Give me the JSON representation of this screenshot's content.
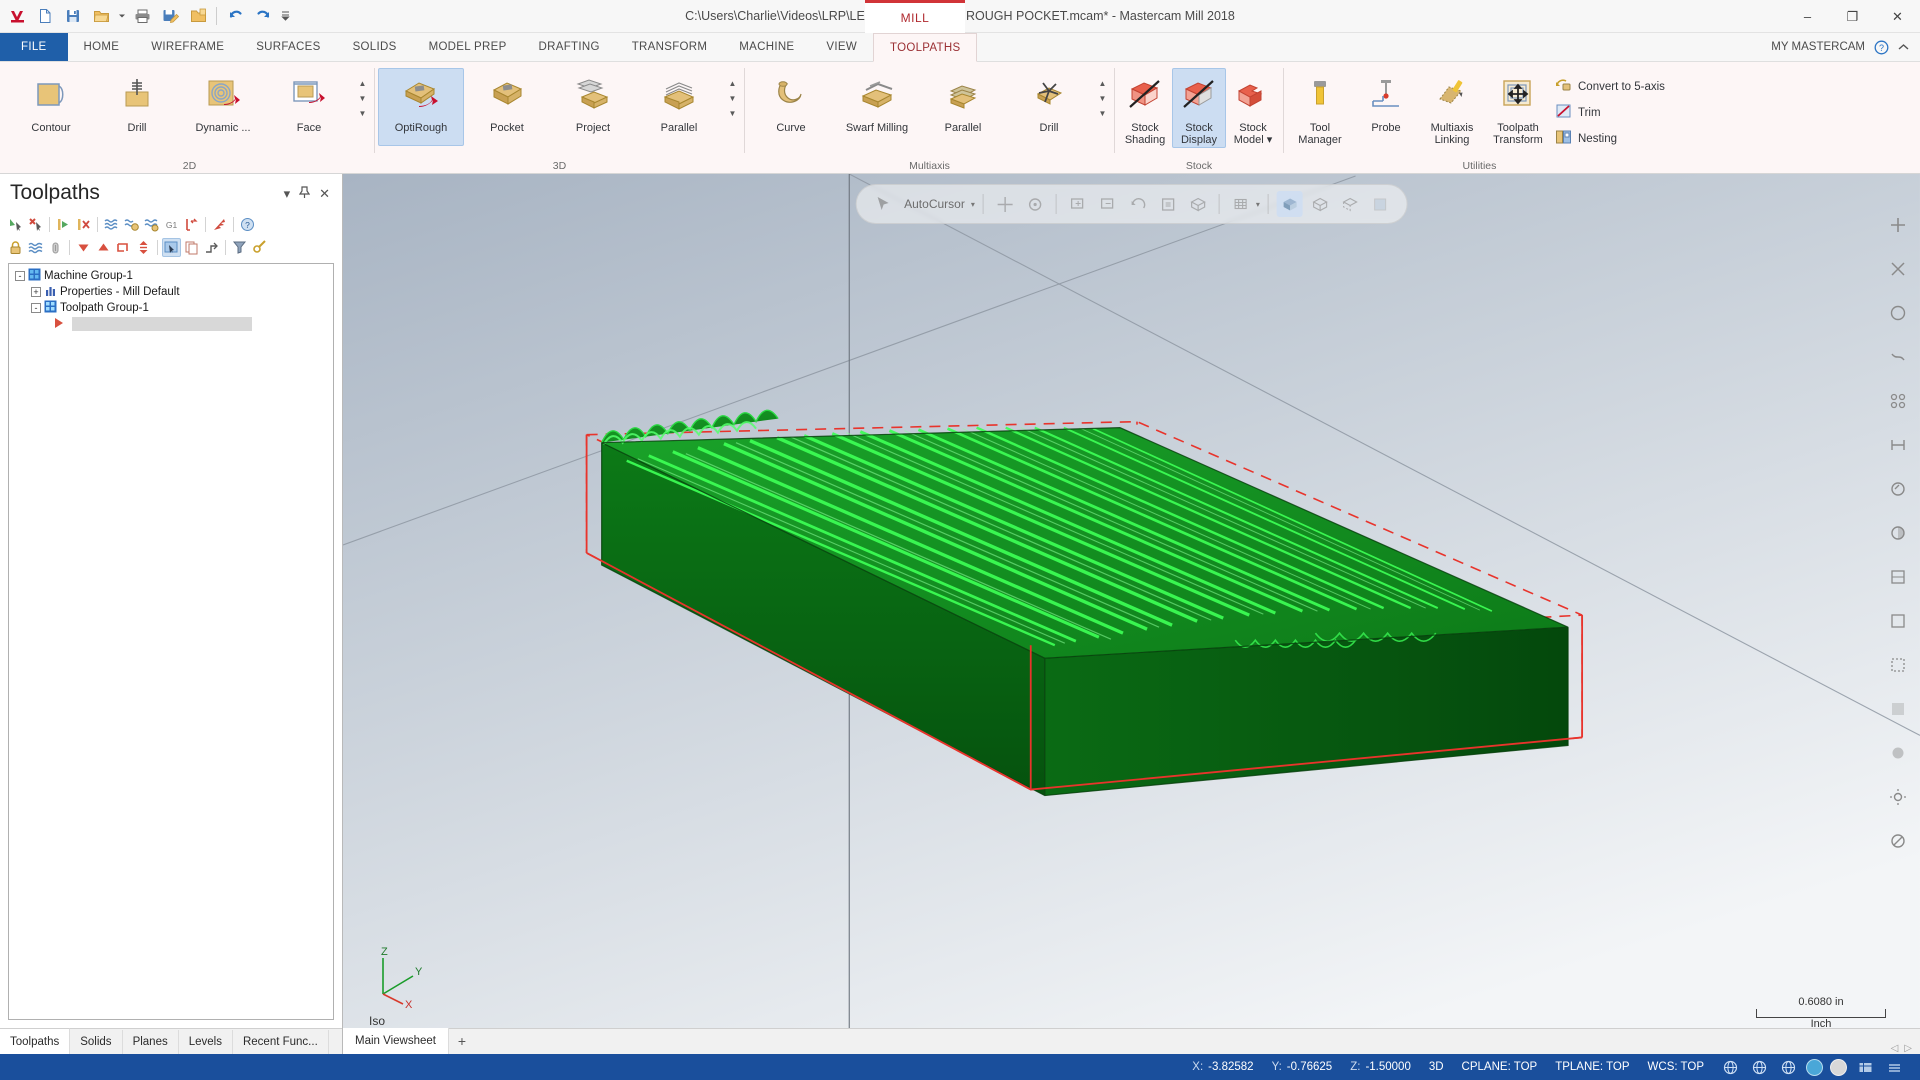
{
  "titlebar": {
    "title": "C:\\Users\\Charlie\\Videos\\LRP\\LEGACY SURFACE ROUGH POCKET.mcam* - Mastercam Mill 2018",
    "mill_tab": "MILL",
    "quick_access": [
      {
        "name": "mastercam-logo-icon",
        "label": "M"
      },
      {
        "name": "new-file-icon",
        "label": "New"
      },
      {
        "name": "save-icon",
        "label": "Save"
      },
      {
        "name": "open-folder-icon",
        "label": "Open"
      },
      {
        "name": "open-dropdown-icon",
        "label": "Open options"
      },
      {
        "name": "print-icon",
        "label": "Print"
      },
      {
        "name": "save-as-icon",
        "label": "Save As"
      },
      {
        "name": "import-folder-icon",
        "label": "Import"
      },
      {
        "name": "undo-icon",
        "label": "Undo"
      },
      {
        "name": "redo-icon",
        "label": "Redo"
      },
      {
        "name": "customize-qat-icon",
        "label": "Customize Quick Access Toolbar"
      }
    ],
    "window_controls": {
      "minimize": "–",
      "maximize": "❐",
      "close": "✕"
    }
  },
  "ribbon_tabs": {
    "items": [
      {
        "label": "FILE",
        "active": false,
        "file": true
      },
      {
        "label": "HOME",
        "active": false
      },
      {
        "label": "WIREFRAME",
        "active": false
      },
      {
        "label": "SURFACES",
        "active": false
      },
      {
        "label": "SOLIDS",
        "active": false
      },
      {
        "label": "MODEL PREP",
        "active": false
      },
      {
        "label": "DRAFTING",
        "active": false
      },
      {
        "label": "TRANSFORM",
        "active": false
      },
      {
        "label": "MACHINE",
        "active": false
      },
      {
        "label": "VIEW",
        "active": false
      },
      {
        "label": "TOOLPATHS",
        "active": true
      }
    ],
    "account_label": "MY MASTERCAM",
    "help_icon": "help-icon",
    "collapse_icon": "collapse-ribbon-icon"
  },
  "ribbon": {
    "groups": [
      {
        "label": "2D",
        "buttons": [
          {
            "label": "Contour",
            "icon": "contour-icon",
            "selected": false
          },
          {
            "label": "Drill",
            "icon": "drill-icon",
            "selected": false
          },
          {
            "label": "Dynamic ...",
            "icon": "dynamic-mill-icon",
            "selected": false
          },
          {
            "label": "Face",
            "icon": "face-icon",
            "selected": false
          }
        ],
        "has_spinner": true
      },
      {
        "label": "3D",
        "buttons": [
          {
            "label": "OptiRough",
            "icon": "optirough-icon",
            "selected": true
          },
          {
            "label": "Pocket",
            "icon": "pocket-icon",
            "selected": false
          },
          {
            "label": "Project",
            "icon": "project-icon",
            "selected": false
          },
          {
            "label": "Parallel",
            "icon": "parallel-icon",
            "selected": false
          }
        ],
        "has_spinner": true
      },
      {
        "label": "Multiaxis",
        "buttons": [
          {
            "label": "Curve",
            "icon": "curve-icon",
            "selected": false
          },
          {
            "label": "Swarf Milling",
            "icon": "swarf-milling-icon",
            "selected": false
          },
          {
            "label": "Parallel",
            "icon": "multiaxis-parallel-icon",
            "selected": false
          },
          {
            "label": "Drill",
            "icon": "multiaxis-drill-icon",
            "selected": false
          }
        ],
        "has_spinner": true
      },
      {
        "label": "Stock",
        "buttons": [
          {
            "label": "Stock Shading",
            "icon": "stock-shading-icon",
            "selected": false
          },
          {
            "label": "Stock Display",
            "icon": "stock-display-icon",
            "selected": true
          },
          {
            "label": "Stock Model",
            "icon": "stock-model-icon",
            "selected": false,
            "dropdown": true
          }
        ],
        "has_spinner": false
      },
      {
        "label": "Utilities",
        "buttons": [
          {
            "label": "Tool Manager",
            "icon": "tool-manager-icon",
            "selected": false
          },
          {
            "label": "Probe",
            "icon": "probe-icon",
            "selected": false
          },
          {
            "label": "Multiaxis Linking",
            "icon": "multiaxis-linking-icon",
            "selected": false
          },
          {
            "label": "Toolpath Transform",
            "icon": "toolpath-transform-icon",
            "selected": false
          }
        ],
        "small_buttons": [
          {
            "label": "Convert to 5-axis",
            "icon": "convert-5axis-icon"
          },
          {
            "label": "Trim",
            "icon": "trim-icon"
          },
          {
            "label": "Nesting",
            "icon": "nesting-icon"
          }
        ]
      }
    ]
  },
  "toolpaths_panel": {
    "title": "Toolpaths",
    "header_icons": [
      {
        "name": "panel-dropdown-icon",
        "glyph": "▾"
      },
      {
        "name": "panel-pin-icon",
        "glyph": "📌"
      },
      {
        "name": "panel-close-icon",
        "glyph": "✕"
      }
    ],
    "toolbar_row1": [
      {
        "name": "select-all-toolpaths-icon",
        "on": false
      },
      {
        "name": "deselect-all-toolpaths-icon",
        "on": false
      },
      {
        "name": "regenerate-selected-icon",
        "on": false
      },
      {
        "name": "regenerate-invalid-icon",
        "on": false
      },
      {
        "name": "backplot-icon",
        "on": false
      },
      {
        "name": "verify-icon",
        "on": false
      },
      {
        "name": "simulate-icon",
        "on": false
      },
      {
        "name": "g1-post-icon",
        "on": false,
        "text": "G1"
      },
      {
        "name": "high-speed-icon",
        "on": false
      },
      {
        "name": "delete-toolpath-icon",
        "on": false
      },
      {
        "name": "help-toolpath-icon",
        "on": false
      }
    ],
    "toolbar_row2": [
      {
        "name": "lock-toolpath-icon",
        "on": false
      },
      {
        "name": "toggle-posting-icon",
        "on": false
      },
      {
        "name": "toggle-toolpath-display-icon",
        "on": false
      },
      {
        "name": "move-down-icon",
        "on": false
      },
      {
        "name": "move-up-icon",
        "on": false
      },
      {
        "name": "toolpath-group-icon",
        "on": false
      },
      {
        "name": "move-insert-arrow-icon",
        "on": false
      },
      {
        "name": "single-select-icon",
        "on": true
      },
      {
        "name": "copy-paste-icon",
        "on": false
      },
      {
        "name": "toolpath-order-icon",
        "on": false
      },
      {
        "name": "filter-icon",
        "on": false
      },
      {
        "name": "settings-toolpath-icon",
        "on": false
      }
    ],
    "tree": [
      {
        "label": "Machine Group-1",
        "indent": 0,
        "icon": "machine-group-icon",
        "expander": "-"
      },
      {
        "label": "Properties - Mill Default",
        "indent": 1,
        "icon": "properties-icon",
        "expander": "+"
      },
      {
        "label": "Toolpath Group-1",
        "indent": 1,
        "icon": "toolpath-group-icon",
        "expander": "-"
      }
    ],
    "insert_marker": "insert-arrow-marker",
    "tabs": [
      {
        "label": "Toolpaths",
        "active": true
      },
      {
        "label": "Solids",
        "active": false
      },
      {
        "label": "Planes",
        "active": false
      },
      {
        "label": "Levels",
        "active": false
      },
      {
        "label": "Recent Func...",
        "active": false
      }
    ]
  },
  "viewport": {
    "autocursor_label": "AutoCursor",
    "autocursor_icon": "autocursor-icon",
    "float_toolbar_icons": [
      {
        "name": "select-entities-icon",
        "on": false
      },
      {
        "name": "snap-point-icon",
        "on": false
      },
      {
        "name": "fit-screen-icon",
        "on": false
      },
      {
        "name": "zoom-window-icon",
        "on": false
      },
      {
        "name": "unzoom-icon",
        "on": false
      },
      {
        "name": "dynamic-rotate-icon",
        "on": false
      },
      {
        "name": "pan-icon",
        "on": false
      },
      {
        "name": "isometric-view-icon",
        "on": false
      },
      {
        "name": "top-view-icon",
        "on": false
      },
      {
        "name": "grid-toggle-icon",
        "on": false
      },
      {
        "name": "shaded-view-icon",
        "on": true
      },
      {
        "name": "wireframe-view-icon",
        "on": false
      },
      {
        "name": "hidden-lines-icon",
        "on": false
      },
      {
        "name": "translucency-icon",
        "on": false
      }
    ],
    "right_rail_icons": [
      {
        "name": "zoom-in-icon",
        "glyph": "+"
      },
      {
        "name": "fit-to-screen-icon",
        "glyph": "⤡"
      },
      {
        "name": "zoom-target-icon",
        "glyph": "◎"
      },
      {
        "name": "dynamic-rotate-icon",
        "glyph": "⤳"
      },
      {
        "name": "view-cube-icon",
        "glyph": "❖"
      },
      {
        "name": "measure-icon",
        "glyph": "⇔"
      },
      {
        "name": "analyze-icon",
        "glyph": "◔"
      },
      {
        "name": "section-view-icon",
        "glyph": "◑"
      },
      {
        "name": "shading-toggle-icon",
        "glyph": "▧"
      },
      {
        "name": "wireframe-toggle-icon",
        "glyph": "□"
      },
      {
        "name": "hidden-lines-toggle-icon",
        "glyph": "◫"
      },
      {
        "name": "translucency-toggle-icon",
        "glyph": "▨"
      },
      {
        "name": "material-icon",
        "glyph": "●"
      },
      {
        "name": "lighting-icon",
        "glyph": "☀"
      },
      {
        "name": "no-display-icon",
        "glyph": "⊘"
      }
    ],
    "gnomon": {
      "x": "X",
      "y": "Y",
      "z": "Z"
    },
    "view_name": "Iso",
    "scale_value": "0.6080 in",
    "scale_unit": "Inch",
    "viewsheet_tabs": [
      {
        "label": "Main Viewsheet",
        "active": true
      }
    ],
    "viewsheet_add": "+",
    "colors": {
      "bg_top": "#b9c3cf",
      "bg_bottom": "#f2f4f6",
      "part_green_dark": "#0b6b14",
      "part_green_light": "#2fe04a",
      "stock_outline": "#e02020"
    }
  },
  "statusbar": {
    "coords": [
      {
        "key": "X:",
        "value": "-3.82582"
      },
      {
        "key": "Y:",
        "value": "-0.76625"
      },
      {
        "key": "Z:",
        "value": "-1.50000"
      }
    ],
    "mode": "3D",
    "cplane": "CPLANE: TOP",
    "tplane": "TPLANE: TOP",
    "wcs": "WCS: TOP",
    "right_icons": [
      {
        "name": "globe-cplane-icon",
        "glyph": "⊕"
      },
      {
        "name": "globe-tplane-icon",
        "glyph": "⊕"
      },
      {
        "name": "globe-wcs-icon",
        "glyph": "⊕"
      },
      {
        "name": "color-swatch-icon",
        "glyph": ""
      },
      {
        "name": "level-color-icon",
        "glyph": ""
      },
      {
        "name": "attributes-icon",
        "glyph": "▤"
      },
      {
        "name": "line-style-icon",
        "glyph": "≡"
      }
    ]
  }
}
